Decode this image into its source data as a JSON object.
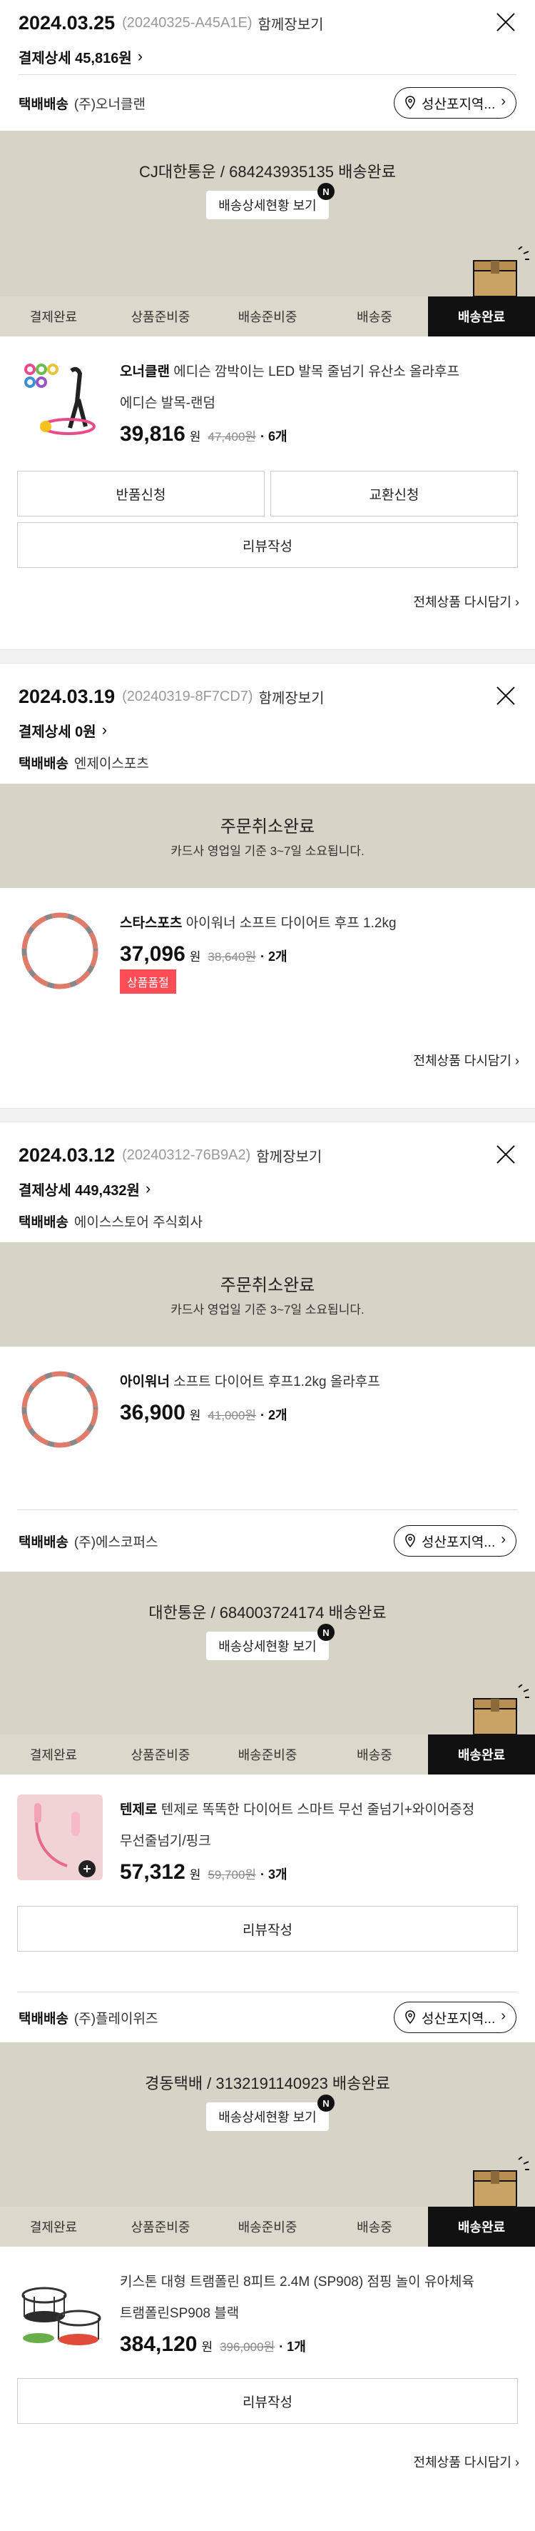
{
  "common": {
    "merge_view": "함께장보기",
    "carrier_label": "택배배송",
    "location_btn": "성산포지역...",
    "track_btn": "배송상세현황 보기",
    "n_badge": "N",
    "steps": [
      "결제완료",
      "상품준비중",
      "배송준비중",
      "배송중",
      "배송완료"
    ],
    "won": "원",
    "review": "리뷰작성",
    "return": "반품신청",
    "exchange": "교환신청",
    "repurchase": "전체상품 다시담기 ",
    "cancel_title": "주문취소완료",
    "cancel_sub": "카드사 영업일 기준 3~7일 소요됩니다.",
    "soldout": "상품품절"
  },
  "order1": {
    "date": "2024.03.25",
    "num": "(20240325-A45A1E)",
    "detail": "결제상세 45,816원",
    "carrier": "(주)오너클랜",
    "track": "CJ대한통운 / 684243935135 배송완료",
    "brand": "오너클랜",
    "name": " 에디슨 깜박이는 LED 발목 줄넘기 유산소 올라후프",
    "opt": "에디슨 발목-랜덤",
    "price": "39,816",
    "orig": "47,400원",
    "qty": "· 6개"
  },
  "order2": {
    "date": "2024.03.19",
    "num": "(20240319-8F7CD7)",
    "detail": "결제상세 0원",
    "carrier": "엔제이스포츠",
    "brand": "스타스포츠",
    "name": " 아이워너 소프트 다이어트 후프 1.2kg",
    "price": "37,096",
    "orig": "38,640원",
    "qty": "· 2개"
  },
  "order3": {
    "date": "2024.03.12",
    "num": "(20240312-76B9A2)",
    "detail": "결제상세 449,432원",
    "carrier": "에이스스토어 주식회사",
    "brand": "아이워너",
    "name": " 소프트 다이어트 후프1.2kg 올라후프",
    "price": "36,900",
    "orig": "41,000원",
    "qty": "· 2개",
    "s2": {
      "carrier": "(주)에스코퍼스",
      "track": "대한통운 / 684003724174 배송완료",
      "brand": "텐제로",
      "name": " 텐제로 똑똑한 다이어트 스마트 무선 줄넘기+와이어증정",
      "opt": "무선줄넘기/핑크",
      "price": "57,312",
      "orig": "59,700원",
      "qty": "· 3개"
    },
    "s3": {
      "carrier": "(주)플레이위즈",
      "track": "경동택배 / 3132191140923 배송완료",
      "name": "키스톤 대형 트램폴린 8피트 2.4M (SP908) 점핑 놀이 유아체육",
      "opt": "트램폴린SP908 블랙",
      "price": "384,120",
      "orig": "396,000원",
      "qty": "· 1개"
    }
  }
}
